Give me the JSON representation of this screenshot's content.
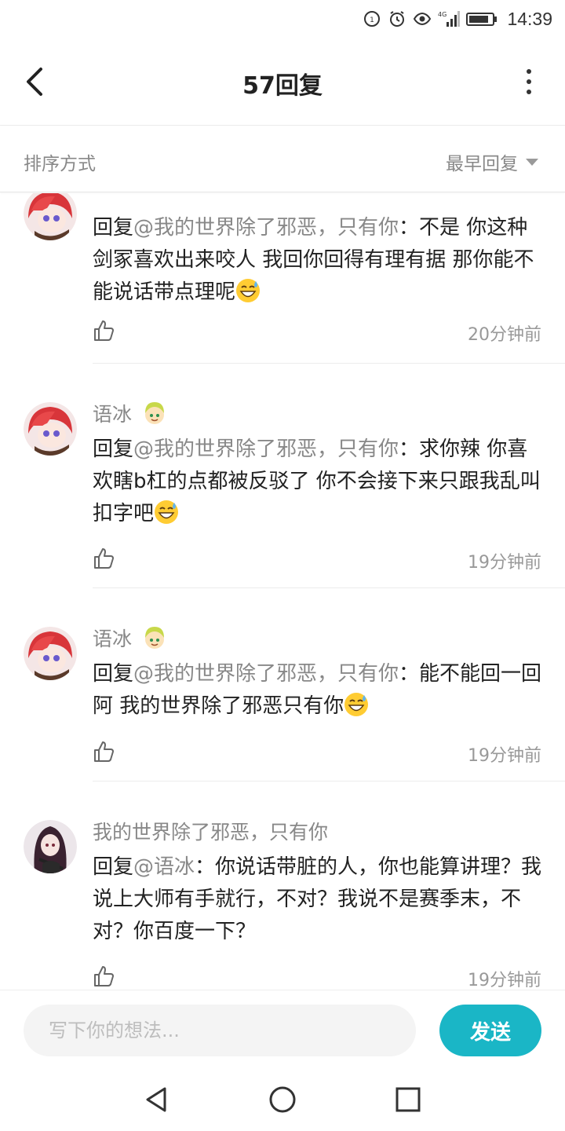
{
  "status_bar": {
    "time": "14:39",
    "network": "4G",
    "icons": [
      "data-saver-icon",
      "alarm-icon",
      "eye-icon",
      "signal-icon",
      "battery-icon"
    ]
  },
  "header": {
    "title": "57回复",
    "back_icon": "chevron-left-icon",
    "more_icon": "more-vertical-icon"
  },
  "sort": {
    "label": "排序方式",
    "selected": "最早回复"
  },
  "comments": [
    {
      "username": "",
      "reply_prefix": "回复",
      "mention": "@我的世界除了邪恶，只有你",
      "text": "：不是 你这种剑冢喜欢出来咬人 我回你回得有理有据 那你能不能说话带点理呢",
      "emoji": "grinning-sweat-emoji",
      "time": "20分钟前"
    },
    {
      "username": "语冰",
      "reply_prefix": "回复",
      "mention": "@我的世界除了邪恶，只有你",
      "text": "：求你辣 你喜欢瞎b杠的点都被反驳了 你不会接下来只跟我乱叫扣字吧",
      "emoji": "grinning-sweat-emoji",
      "time": "19分钟前"
    },
    {
      "username": "语冰",
      "reply_prefix": "回复",
      "mention": "@我的世界除了邪恶，只有你",
      "text": "：能不能回一回阿 我的世界除了邪恶只有你",
      "emoji": "grinning-sweat-emoji",
      "time": "19分钟前"
    },
    {
      "username": "我的世界除了邪恶，只有你",
      "reply_prefix": "回复",
      "mention": "@语冰",
      "text": "：你说话带脏的人，你也能算讲理？我说上大师有手就行，不对？我说不是赛季末，不对？你百度一下？",
      "emoji": "",
      "time": "19分钟前"
    }
  ],
  "input": {
    "placeholder": "写下你的想法...",
    "send_label": "发送"
  },
  "colors": {
    "accent": "#1ab6c6",
    "muted_text": "#888888",
    "body_text": "#222222"
  },
  "nav": [
    "back-triangle-icon",
    "home-circle-icon",
    "recents-square-icon"
  ]
}
